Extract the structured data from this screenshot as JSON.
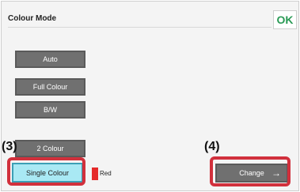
{
  "dialog": {
    "title": "Colour Mode",
    "ok_label": "OK"
  },
  "modes": {
    "auto": "Auto",
    "full_colour": "Full Colour",
    "bw": "B/W",
    "two_colour": "2 Colour",
    "single_colour": "Single Colour"
  },
  "colour": {
    "name": "Red",
    "swatch_hex": "#e52a2a"
  },
  "change": {
    "label": "Change",
    "arrow_icon": "→"
  },
  "callouts": {
    "step3": "(3)",
    "step4": "(4)"
  },
  "colors": {
    "highlight": "#d1303c",
    "ok_accent": "#2a9a55",
    "selected_fill": "#a9e9f4"
  }
}
